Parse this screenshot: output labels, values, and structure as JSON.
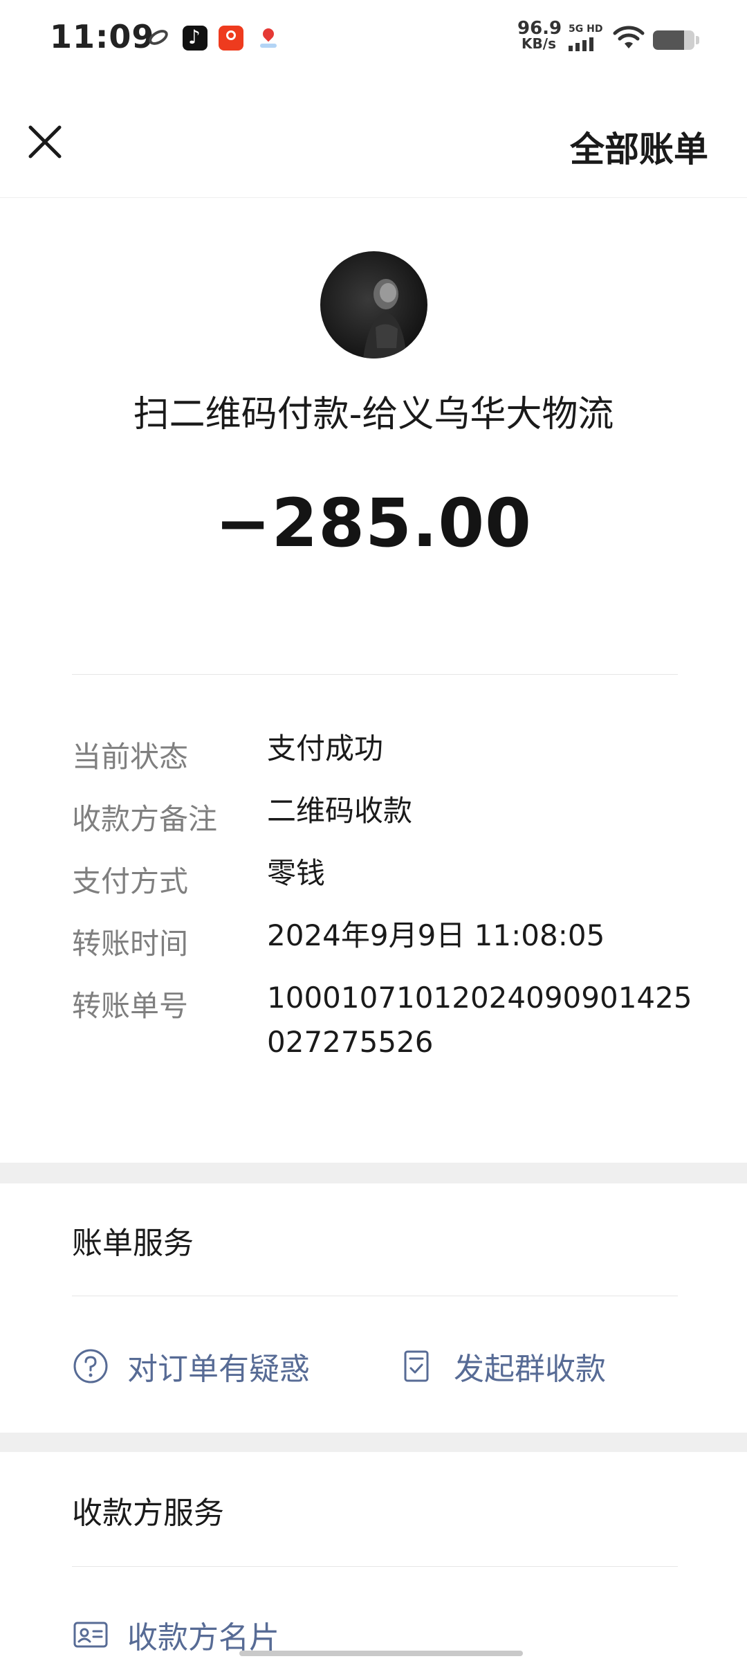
{
  "status_bar": {
    "time": "11:09",
    "net_speed_value": "96.9",
    "net_speed_unit": "KB/s",
    "network_label": "5G HD",
    "battery_level": 0.75,
    "app_icons": [
      "link-app-icon",
      "tiktok-icon",
      "taobao-icon",
      "map-pin-app-icon"
    ]
  },
  "nav": {
    "close_icon": "close-icon",
    "right_label": "全部账单"
  },
  "header": {
    "avatar_icon": "payee-avatar",
    "title": "扫二维码付款-给义乌华大物流",
    "amount": "−285.00"
  },
  "details": [
    {
      "label": "当前状态",
      "value": "支付成功"
    },
    {
      "label": "收款方备注",
      "value": "二维码收款"
    },
    {
      "label": "支付方式",
      "value": "零钱"
    },
    {
      "label": "转账时间",
      "value": "2024年9月9日 11:08:05"
    },
    {
      "label": "转账单号",
      "value_line1": "10001071012024090901425",
      "value_line2": "027275526"
    }
  ],
  "bill_services": {
    "title": "账单服务",
    "links": [
      {
        "label": "对订单有疑惑",
        "icon": "question-icon"
      },
      {
        "label": "发起群收款",
        "icon": "group-collect-icon"
      }
    ]
  },
  "payee_services": {
    "title": "收款方服务",
    "links": [
      {
        "label": "收款方名片",
        "icon": "business-card-icon"
      }
    ]
  },
  "colors": {
    "link": "#576b95",
    "label_gray": "#7f7f7f",
    "separator": "#efefef"
  }
}
